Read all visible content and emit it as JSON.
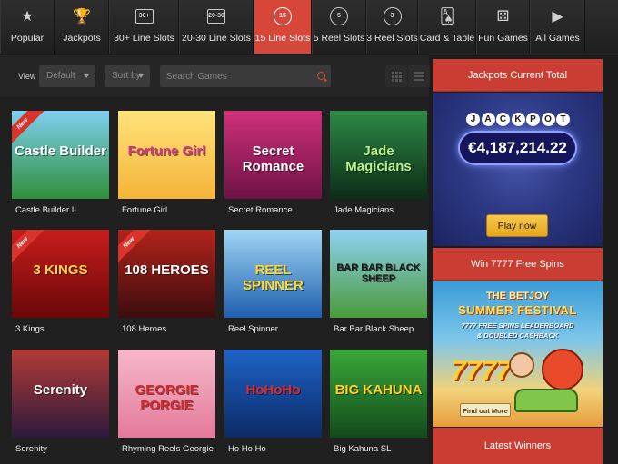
{
  "nav": {
    "items": [
      {
        "label": "Popular",
        "icon": "star-icon",
        "glyph": "★"
      },
      {
        "label": "Jackpots",
        "icon": "trophy-icon",
        "glyph": "🏆"
      },
      {
        "label": "30+ Line Slots",
        "icon": "slot-30-icon",
        "glyph": "30+"
      },
      {
        "label": "20-30 Line Slots",
        "icon": "slot-20-30-icon",
        "glyph": "20-30"
      },
      {
        "label": "15 Line Slots",
        "icon": "slot-15-icon",
        "glyph": "15"
      },
      {
        "label": "5 Reel Slots",
        "icon": "reel-5-icon",
        "glyph": "5"
      },
      {
        "label": "3 Reel Slots",
        "icon": "reel-3-icon",
        "glyph": "3"
      },
      {
        "label": "Card & Table",
        "icon": "cards-icon",
        "glyph": "🂡"
      },
      {
        "label": "Fun Games",
        "icon": "dice-icon",
        "glyph": "⚄"
      },
      {
        "label": "All Games",
        "icon": "play-circle-icon",
        "glyph": "▶"
      }
    ],
    "active_index": 4
  },
  "filters": {
    "view_label": "View",
    "view_select": "Default",
    "sort_select": "Sort by",
    "search_placeholder": "Search Games"
  },
  "games": [
    {
      "name": "Castle Builder II",
      "badge": "New",
      "art": "Castle Builder",
      "bg": [
        "#7fd0f0",
        "#2e8f3a"
      ],
      "fg": "#ffffff"
    },
    {
      "name": "Fortune Girl",
      "badge": "",
      "art": "Fortune Girl",
      "bg": [
        "#ffe37a",
        "#f5b43a"
      ],
      "fg": "#d8348a"
    },
    {
      "name": "Secret Romance",
      "badge": "",
      "art": "Secret Romance",
      "bg": [
        "#d0307a",
        "#6e1245"
      ],
      "fg": "#ffffff"
    },
    {
      "name": "Jade Magicians",
      "badge": "",
      "art": "Jade Magicians",
      "bg": [
        "#2d8a45",
        "#0c2c18"
      ],
      "fg": "#b8f08a"
    },
    {
      "name": "3 Kings",
      "badge": "New",
      "art": "3 KINGS",
      "bg": [
        "#c81c1c",
        "#6a0808"
      ],
      "fg": "#ffd24a"
    },
    {
      "name": "108 Heroes",
      "badge": "New",
      "art": "108 HEROES",
      "bg": [
        "#b3231c",
        "#3c0c0c"
      ],
      "fg": "#ffffff"
    },
    {
      "name": "Reel Spinner",
      "badge": "",
      "art": "REEL SPINNER",
      "bg": [
        "#9fd6f5",
        "#1f5fae"
      ],
      "fg": "#ffd82a"
    },
    {
      "name": "Bar Bar Black Sheep",
      "badge": "",
      "art": "BAR BAR BLACK SHEEP",
      "bg": [
        "#8ed2f2",
        "#4a9a3a"
      ],
      "fg": "#1a1a1a"
    },
    {
      "name": "Serenity",
      "badge": "",
      "art": "Serenity",
      "bg": [
        "#b33a36",
        "#2c1a3c"
      ],
      "fg": "#ffffff"
    },
    {
      "name": "Rhyming Reels Georgie ...",
      "badge": "",
      "art": "GEORGIE PORGIE",
      "bg": [
        "#f6b8c8",
        "#e47a9a"
      ],
      "fg": "#d8282a"
    },
    {
      "name": "Ho Ho Ho",
      "badge": "",
      "art": "HoHoHo",
      "bg": [
        "#1e63c7",
        "#0c2a66"
      ],
      "fg": "#e32a2a"
    },
    {
      "name": "Big Kahuna SL",
      "badge": "",
      "art": "BIG KAHUNA",
      "bg": [
        "#3aa83a",
        "#124a1a"
      ],
      "fg": "#ffd12a"
    }
  ],
  "jackpot": {
    "header": "Jackpots Current Total",
    "letters": [
      "J",
      "A",
      "C",
      "K",
      "P",
      "O",
      "T"
    ],
    "amount": "€4,187,214.22",
    "play_label": "Play now"
  },
  "free_spins": {
    "header": "Win 7777 Free Spins",
    "line1": "THE BETJOY",
    "line2": "SUMMER FESTIVAL",
    "line3": "7777 FREE SPINS LEADERBOARD",
    "line4": "& DOUBLED CASHBACK",
    "reels": "7777",
    "find_label": "Find out More"
  },
  "winners": {
    "header": "Latest Winners"
  }
}
